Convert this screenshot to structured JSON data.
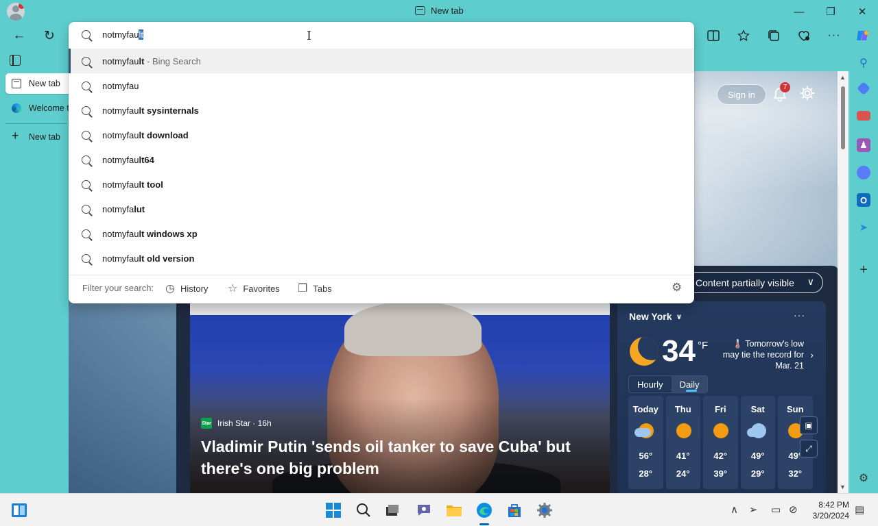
{
  "window": {
    "title": "New tab",
    "minimize": "—",
    "restore": "❐",
    "close": "✕"
  },
  "toolbar": {
    "back": "←",
    "refresh": "↻"
  },
  "vertical_tabs": [
    {
      "label": "New tab",
      "active": true
    },
    {
      "label": "Welcome t"
    },
    {
      "label": "New tab",
      "is_new_button": true
    }
  ],
  "address": {
    "typed": "notmyfau",
    "selected_completion": "lt"
  },
  "suggestions": [
    {
      "prefix": "notmyfau",
      "bold": "lt",
      "suffix": " - Bing Search"
    },
    {
      "prefix": "notmyfau",
      "bold": "",
      "suffix": ""
    },
    {
      "prefix": "notmyfau",
      "bold": "lt sysinternals",
      "suffix": ""
    },
    {
      "prefix": "notmyfau",
      "bold": "lt download",
      "suffix": ""
    },
    {
      "prefix": "notmyfau",
      "bold": "lt64",
      "suffix": ""
    },
    {
      "prefix": "notmyfau",
      "bold": "lt tool",
      "suffix": ""
    },
    {
      "prefix": "notmyfa",
      "bold": "lut",
      "suffix": ""
    },
    {
      "prefix": "notmyfau",
      "bold": "lt windows xp",
      "suffix": ""
    },
    {
      "prefix": "notmyfau",
      "bold": "lt old version",
      "suffix": ""
    }
  ],
  "filter": {
    "label": "Filter your search:",
    "history": "History",
    "favorites": "Favorites",
    "tabs": "Tabs"
  },
  "newtab": {
    "sign_in": "Sign in",
    "notifications": "7",
    "content_visibility": "Content partially visible"
  },
  "news": {
    "source": "Irish Star · 16h",
    "source_logo": "Star",
    "headline": "Vladimir Putin 'sends oil tanker to save Cuba' but there's one big problem"
  },
  "weather": {
    "location": "New York",
    "more": "···",
    "temperature": "34",
    "unit": "°F",
    "note": "🌡️ Tomorrow's low may tie the record for Mar. 21",
    "tab_hourly": "Hourly",
    "tab_daily": "Daily",
    "days": [
      {
        "name": "Today",
        "hi": "56°",
        "lo": "28°",
        "icon": "cloudy-sun"
      },
      {
        "name": "Thu",
        "hi": "41°",
        "lo": "24°",
        "icon": "sun"
      },
      {
        "name": "Fri",
        "hi": "42°",
        "lo": "39°",
        "icon": "sun"
      },
      {
        "name": "Sat",
        "hi": "49°",
        "lo": "29°",
        "icon": "cloudy-rain"
      },
      {
        "name": "Sun",
        "hi": "49°",
        "lo": "32°",
        "icon": "sun"
      }
    ]
  },
  "taskbar": {
    "time": "8:42 PM",
    "date": "3/20/2024"
  },
  "colors": {
    "desktop_bg": "#5ecdcd",
    "accent": "#3d6fb8",
    "weather_bg": "#243a5e"
  }
}
